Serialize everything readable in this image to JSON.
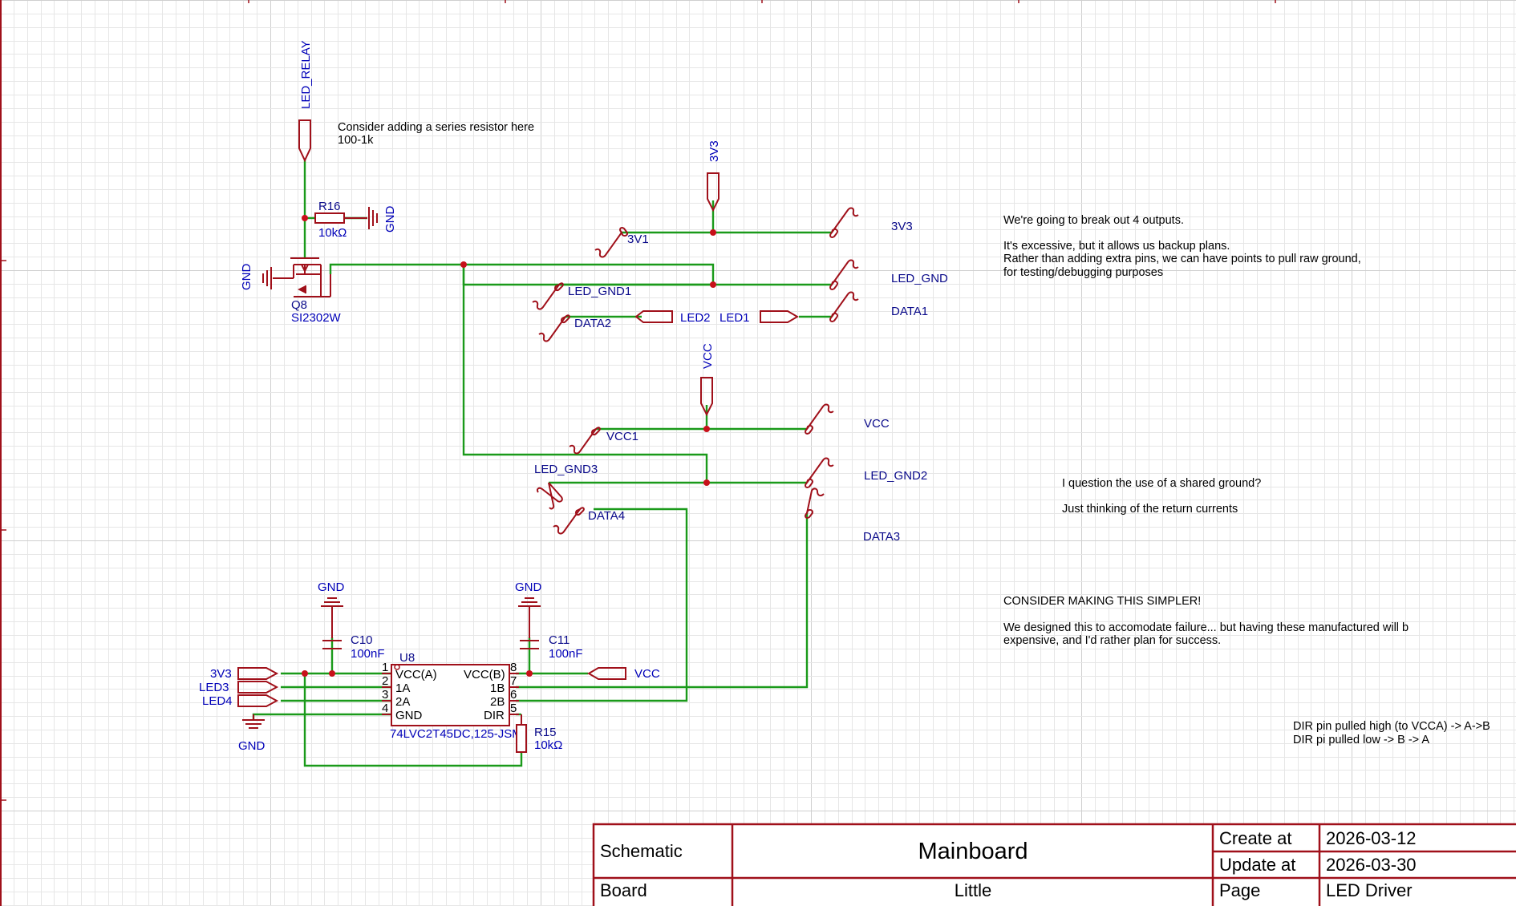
{
  "notes": {
    "series_resistor": [
      "Consider adding a series resistor here",
      "100-1k"
    ],
    "outputs": [
      "We're going to break out 4 outputs.",
      "",
      "It's excessive, but it allows us backup plans.",
      "Rather than adding extra pins, we can have points to pull raw ground,",
      "for testing/debugging purposes"
    ],
    "shared_ground": [
      "I question the use of a shared ground?",
      "",
      "Just thinking of the return currents"
    ],
    "simpler": [
      "CONSIDER MAKING THIS SIMPLER!",
      "",
      "We designed this to accomodate failure... but having these manufactured will b",
      "expensive, and I'd rather plan for success."
    ],
    "dir_pin": [
      "DIR pin pulled high (to VCCA) -> A->B",
      "DIR pi pulled low -> B -> A"
    ]
  },
  "net_ports": {
    "led_relay": "LED_RELAY",
    "p3v3_top": "3V3",
    "vcc_mid": "VCC",
    "p3v3_u8": "3V3",
    "led3": "LED3",
    "led4": "LED4",
    "vcc_u8": "VCC",
    "led2": "LED2",
    "led1": "LED1"
  },
  "power": {
    "gnd_r16": "GND",
    "gnd_q8": "GND",
    "gnd_c10": "GND",
    "gnd_c11": "GND",
    "gnd_u8": "GND"
  },
  "components": {
    "r16": {
      "ref": "R16",
      "value": "10kΩ"
    },
    "q8": {
      "ref": "Q8",
      "value": "SI2302W"
    },
    "c10": {
      "ref": "C10",
      "value": "100nF"
    },
    "c11": {
      "ref": "C11",
      "value": "100nF"
    },
    "r15": {
      "ref": "R15",
      "value": "10kΩ"
    },
    "u8": {
      "ref": "U8",
      "value": "74LVC2T45DC,125-JSM",
      "pins_left": [
        {
          "num": "1",
          "name": "VCC(A)"
        },
        {
          "num": "2",
          "name": "1A"
        },
        {
          "num": "3",
          "name": "2A"
        },
        {
          "num": "4",
          "name": "GND"
        }
      ],
      "pins_right": [
        {
          "num": "8",
          "name": "VCC(B)"
        },
        {
          "num": "7",
          "name": "1B"
        },
        {
          "num": "6",
          "name": "2B"
        },
        {
          "num": "5",
          "name": "DIR"
        }
      ]
    }
  },
  "test_points": {
    "t3v1": "3V1",
    "t3v3": "3V3",
    "led_gnd1": "LED_GND1",
    "led_gnd": "LED_GND",
    "data2": "DATA2",
    "data1": "DATA1",
    "vcc1": "VCC1",
    "vcc": "VCC",
    "led_gnd3": "LED_GND3",
    "led_gnd2": "LED_GND2",
    "data4": "DATA4",
    "data3": "DATA3"
  },
  "title_block": {
    "schematic": "Schematic",
    "mainboard": "Mainboard",
    "create_label": "Create at",
    "create_date": "2026-03-12",
    "update_label": "Update at",
    "update_date": "2026-03-30",
    "board_label": "Board",
    "board_value": "Little",
    "page_label": "Page",
    "page_value": "LED Driver"
  },
  "colors": {
    "wire": "#1a9a1a",
    "symbol": "#a0101a",
    "label": "#0000b8",
    "junction": "#c8101a"
  }
}
